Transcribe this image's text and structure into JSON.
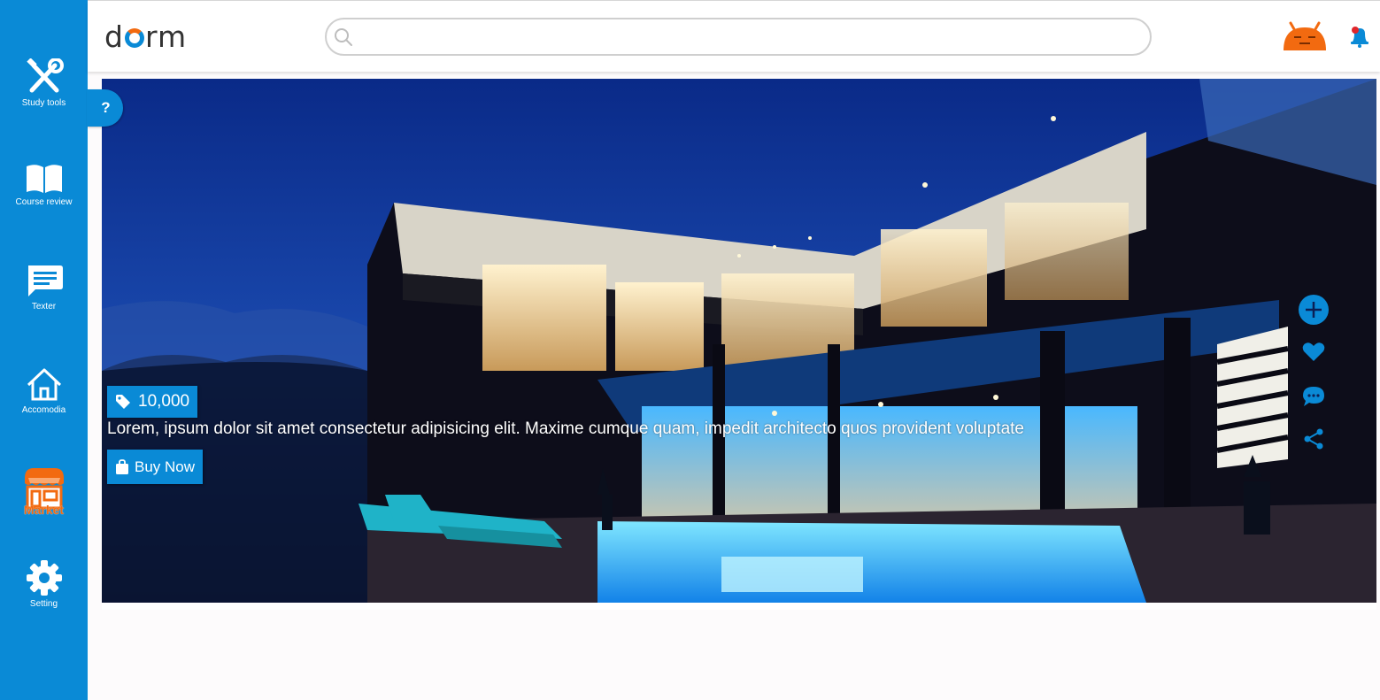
{
  "app": {
    "logo_text_before": "d",
    "logo_text_after": "rm"
  },
  "sidebar": {
    "items": [
      {
        "label": "Study tools",
        "icon": "tools-icon"
      },
      {
        "label": "Course review",
        "icon": "book-icon"
      },
      {
        "label": "Texter",
        "icon": "chat-icon"
      },
      {
        "label": "Accomodia",
        "icon": "home-icon"
      },
      {
        "label": "Market",
        "icon": "store-icon",
        "active": true
      },
      {
        "label": "Setting",
        "icon": "gear-icon"
      }
    ],
    "help_label": "?"
  },
  "header": {
    "search": {
      "value": "",
      "placeholder": ""
    }
  },
  "listing": {
    "price": "10,000",
    "description": "Lorem, ipsum dolor sit amet consectetur adipisicing elit. Maxime cumque quam, impedit architecto quos provident voluptate",
    "buy_label": "Buy Now"
  },
  "colors": {
    "primary": "#0a8ad6",
    "accent": "#f26a10",
    "background": "#fdfbfc"
  }
}
